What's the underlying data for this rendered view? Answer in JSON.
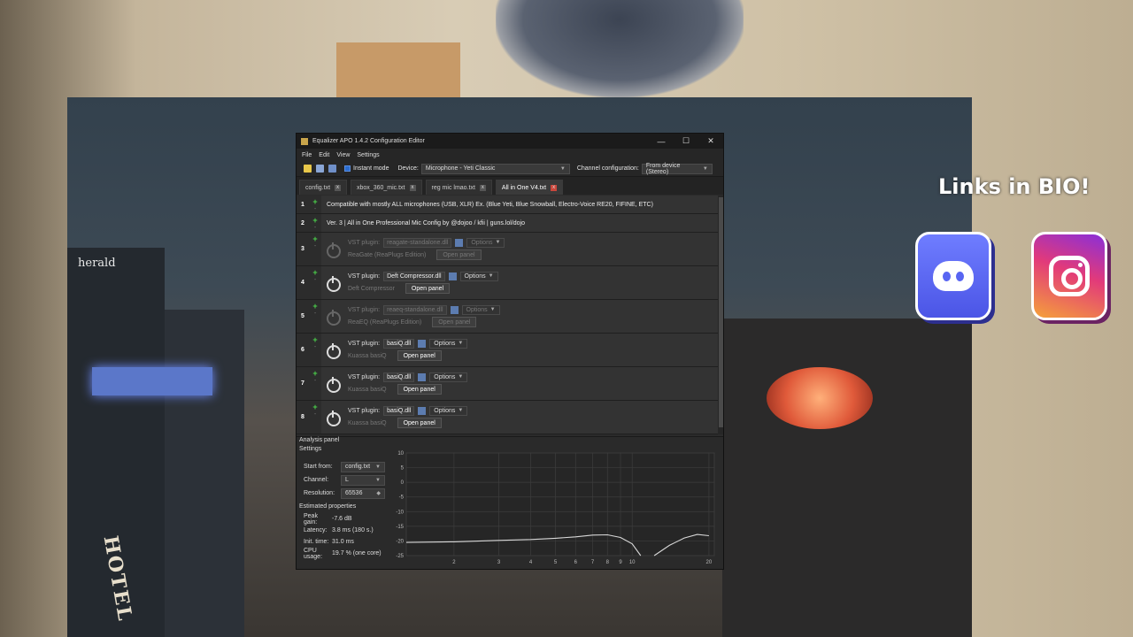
{
  "overlay": {
    "links_title": "Links in BIO!"
  },
  "scene": {
    "hotel_sign": "HOTEL",
    "emblem_text": "herald"
  },
  "window": {
    "title": "Equalizer APO 1.4.2 Configuration Editor",
    "controls": {
      "minimize": "—",
      "maximize": "☐",
      "close": "✕"
    }
  },
  "menu": [
    "File",
    "Edit",
    "View",
    "Settings"
  ],
  "toolbar": {
    "instant_mode": "Instant mode",
    "device_label": "Device:",
    "device_value": "Microphone - Yeti Classic",
    "channel_label": "Channel configuration:",
    "channel_value": "From device (Stereo)"
  },
  "tabs": [
    {
      "label": "config.txt",
      "active": false
    },
    {
      "label": "xbox_360_mic.txt",
      "active": false
    },
    {
      "label": "reg mic lmao.txt",
      "active": false
    },
    {
      "label": "All in One V4.txt",
      "active": true
    }
  ],
  "rows": [
    {
      "num": "1",
      "text": "Compatible with mostly ALL microphones (USB, XLR) Ex. (Blue Yeti, Blue Snowball, Electro-Voice RE20, FIFINE, ETC)"
    },
    {
      "num": "2",
      "text": "Ver. 3 | All in One Professional Mic Config by @dojoo / kfii | guns.lol/dojo"
    }
  ],
  "plugins": [
    {
      "num": "3",
      "enabled": false,
      "label": "VST plugin:",
      "file": "reagate-standalone.dll",
      "options": "Options",
      "name": "ReaGate (ReaPlugs Edition)",
      "open": "Open panel"
    },
    {
      "num": "4",
      "enabled": true,
      "label": "VST plugin:",
      "file": "Deft Compressor.dll",
      "options": "Options",
      "name": "Deft Compressor",
      "open": "Open panel"
    },
    {
      "num": "5",
      "enabled": false,
      "label": "VST plugin:",
      "file": "reaeq-standalone.dll",
      "options": "Options",
      "name": "ReaEQ (ReaPlugs Edition)",
      "open": "Open panel"
    },
    {
      "num": "6",
      "enabled": true,
      "label": "VST plugin:",
      "file": "basiQ.dll",
      "options": "Options",
      "name": "Kuassa basiQ",
      "open": "Open panel"
    },
    {
      "num": "7",
      "enabled": true,
      "label": "VST plugin:",
      "file": "basiQ.dll",
      "options": "Options",
      "name": "Kuassa basiQ",
      "open": "Open panel"
    },
    {
      "num": "8",
      "enabled": true,
      "label": "VST plugin:",
      "file": "basiQ.dll",
      "options": "Options",
      "name": "Kuassa basiQ",
      "open": "Open panel"
    }
  ],
  "analysis": {
    "title": "Analysis panel",
    "settings_title": "Settings",
    "start_from_label": "Start from:",
    "start_from_value": "config.txt",
    "channel_label": "Channel:",
    "channel_value": "L",
    "resolution_label": "Resolution:",
    "resolution_value": "65536",
    "estimated_title": "Estimated properties",
    "peak_gain_label": "Peak gain:",
    "peak_gain_value": "-7.6 dB",
    "latency_label": "Latency:",
    "latency_value": "3.8 ms (180 s.)",
    "init_time_label": "Init. time:",
    "init_time_value": "31.0 ms",
    "cpu_label": "CPU usage:",
    "cpu_value": "19.7 % (one core)"
  },
  "chart_data": {
    "type": "line",
    "y_ticks": [
      "10",
      "5",
      "0",
      "-5",
      "-10",
      "-15",
      "-20",
      "-25"
    ],
    "x_ticks": [
      "2",
      "3",
      "4",
      "5",
      "6",
      "7",
      "8",
      "9",
      "10",
      "20"
    ],
    "ylim": [
      -25,
      10
    ],
    "series": [
      {
        "points": [
          [
            1.3,
            -20.5
          ],
          [
            2,
            -20.3
          ],
          [
            3,
            -19.8
          ],
          [
            4,
            -19.5
          ],
          [
            5,
            -19.1
          ],
          [
            6,
            -18.6
          ],
          [
            7,
            -18.0
          ],
          [
            8,
            -17.9
          ],
          [
            9,
            -18.8
          ],
          [
            10,
            -21
          ],
          [
            10.8,
            -25
          ]
        ]
      },
      {
        "points": [
          [
            12.2,
            -25
          ],
          [
            14,
            -21.5
          ],
          [
            16,
            -19.0
          ],
          [
            18,
            -17.8
          ],
          [
            20,
            -18.2
          ]
        ]
      }
    ]
  }
}
